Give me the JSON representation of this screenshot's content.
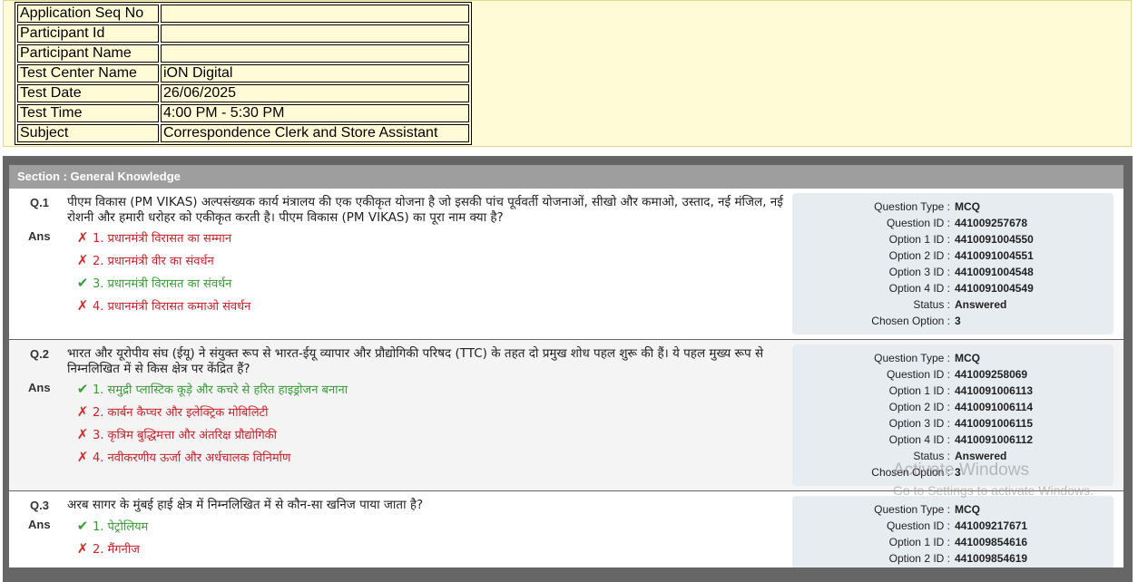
{
  "candidate_info": [
    {
      "label": "Application Seq No",
      "value": ""
    },
    {
      "label": "Participant Id",
      "value": ""
    },
    {
      "label": "Participant Name",
      "value": ""
    },
    {
      "label": "Test Center Name",
      "value": "iON Digital"
    },
    {
      "label": "Test Date",
      "value": "26/06/2025"
    },
    {
      "label": "Test Time",
      "value": "4:00 PM - 5:30 PM"
    },
    {
      "label": "Subject",
      "value": "Correspondence Clerk and Store Assistant"
    }
  ],
  "section": {
    "title": "Section : General Knowledge"
  },
  "ans_label": "Ans",
  "meta_labels": {
    "type": "Question Type :",
    "qid": "Question ID :",
    "o1": "Option 1 ID :",
    "o2": "Option 2 ID :",
    "o3": "Option 3 ID :",
    "o4": "Option 4 ID :",
    "status": "Status :",
    "chosen": "Chosen Option :"
  },
  "questions": [
    {
      "number": "Q.1",
      "text": "पीएम विकास (PM VIKAS) अल्पसंख्यक कार्य मंत्रालय की एक एकीकृत योजना है जो इसकी पांच पूर्ववर्ती योजनाओं, सीखो और कमाओ, उस्ताद, नई मंजिल, नई रोशनी और हमारी धरोहर को एकीकृत करती है। पीएम विकास (PM VIKAS) का पूरा नाम क्या है?",
      "options": [
        {
          "text": "1. प्रधानमंत्री विरासत का सम्मान",
          "correct": false
        },
        {
          "text": "2. प्रधानमंत्री वीर का संवर्धन",
          "correct": false
        },
        {
          "text": "3. प्रधानमंत्री विरासत का संवर्धन",
          "correct": true
        },
        {
          "text": "4. प्रधानमंत्री विरासत कमाओ संवर्धन",
          "correct": false
        }
      ],
      "meta": {
        "type": "MCQ",
        "qid": "441009257678",
        "o1": "4410091004550",
        "o2": "4410091004551",
        "o3": "4410091004548",
        "o4": "4410091004549",
        "status": "Answered",
        "chosen": "3"
      }
    },
    {
      "number": "Q.2",
      "text": "भारत और यूरोपीय संघ (ईयू) ने संयुक्त रूप से भारत-ईयू व्यापार और प्रौद्योगिकी परिषद (TTC) के तहत दो प्रमुख शोध पहल शुरू की हैं। ये पहल मुख्य रूप से निम्नलिखित में से किस क्षेत्र पर केंद्रित हैं?",
      "options": [
        {
          "text": "1. समुद्री प्लास्टिक कूड़े और कचरे से हरित हाइड्रोजन बनाना",
          "correct": true
        },
        {
          "text": "2. कार्बन कैप्चर और इलेक्ट्रिक मोबिलिटी",
          "correct": false
        },
        {
          "text": "3. कृत्रिम बुद्धिमत्ता और अंतरिक्ष प्रौद्योगिकी",
          "correct": false
        },
        {
          "text": "4. नवीकरणीय ऊर्जा और अर्धचालक विनिर्माण",
          "correct": false
        }
      ],
      "meta": {
        "type": "MCQ",
        "qid": "441009258069",
        "o1": "4410091006113",
        "o2": "4410091006114",
        "o3": "4410091006115",
        "o4": "4410091006112",
        "status": "Answered",
        "chosen": "3"
      }
    },
    {
      "number": "Q.3",
      "text": "अरब सागर के मुंबई हाई क्षेत्र में निम्नलिखित में से कौन-सा खनिज पाया जाता है?",
      "options": [
        {
          "text": "1. पेट्रोलियम",
          "correct": true
        },
        {
          "text": "2. मैंगनीज",
          "correct": false
        }
      ],
      "meta": {
        "type": "MCQ",
        "qid": "441009217671",
        "o1": "441009854616",
        "o2": "441009854619"
      }
    }
  ],
  "watermark": {
    "title": "Activate Windows",
    "subtitle": "Go to Settings to activate Windows."
  },
  "colors": {
    "correct": "#3b9a3b",
    "wrong": "#c8232c",
    "section_bar": "#9e9e9e",
    "info_bg": "#fffbd6"
  }
}
